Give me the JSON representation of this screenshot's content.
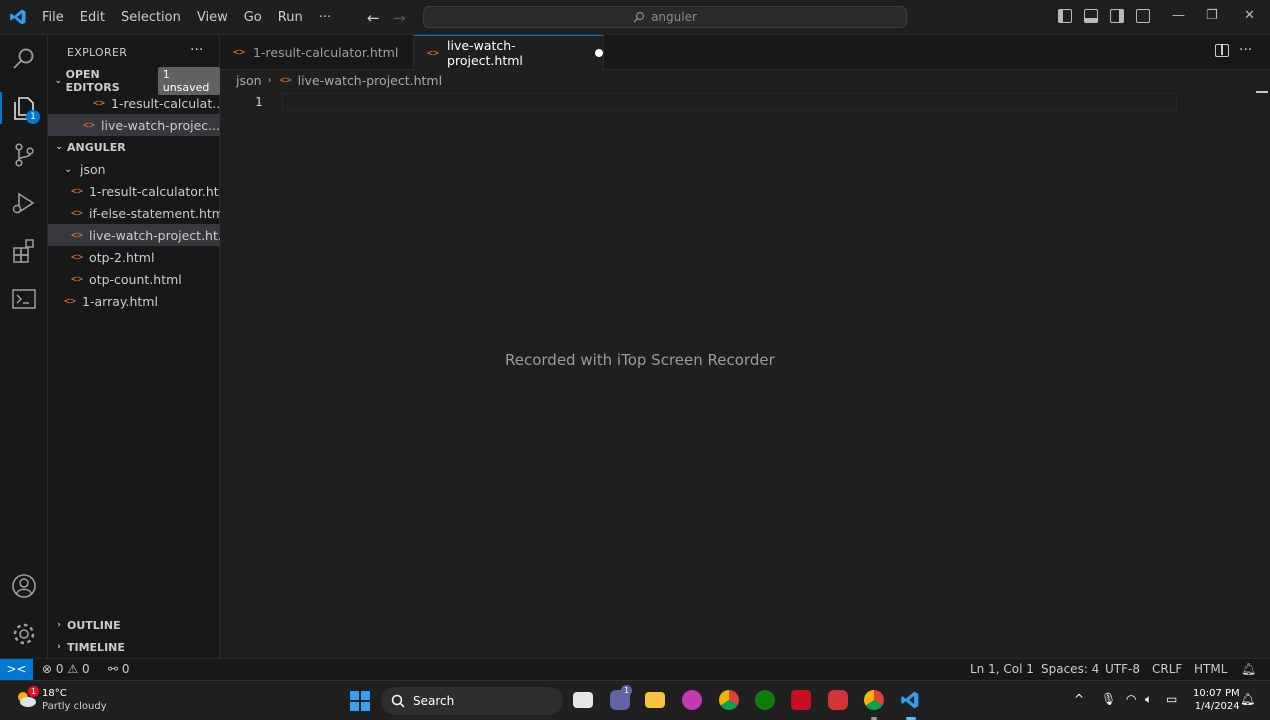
{
  "titlebar": {
    "menu": [
      "File",
      "Edit",
      "Selection",
      "View",
      "Go",
      "Run",
      "···"
    ],
    "search_text": "anguler",
    "window_controls": [
      "minimize-icon",
      "restore-icon",
      "close-icon"
    ]
  },
  "sidebar": {
    "title": "EXPLORER",
    "more": "···",
    "open_editors": {
      "label": "OPEN EDITORS",
      "badge": "1 unsaved",
      "items": [
        "1-result-calculat...",
        "live-watch-projec..."
      ]
    },
    "folder": {
      "label": "ANGULER",
      "subfolder": "json",
      "files": [
        "1-result-calculator.ht...",
        "if-else-statement.html",
        "live-watch-project.ht...",
        "otp-2.html",
        "otp-count.html"
      ],
      "root_files": [
        "1-array.html"
      ]
    },
    "outline": "OUTLINE",
    "timeline": "TIMELINE"
  },
  "tabs": [
    {
      "label": "1-result-calculator.html",
      "active": false
    },
    {
      "label": "live-watch-project.html",
      "active": true,
      "modified": true
    }
  ],
  "editor": {
    "breadcrumb": [
      "json",
      "live-watch-project.html"
    ],
    "line_number": "1",
    "watermark": "Recorded with iTop Screen Recorder"
  },
  "statusbar": {
    "remote_icon": "><",
    "errors": "0",
    "warnings": "0",
    "ports": "0",
    "position": "Ln 1, Col 1",
    "spaces": "Spaces: 4",
    "encoding": "UTF-8",
    "eol": "CRLF",
    "language": "HTML"
  },
  "taskbar": {
    "temperature": "18°C",
    "condition": "Partly cloudy",
    "search_label": "Search",
    "time": "10:07 PM",
    "date": "1/4/2024",
    "weather_alert": "1",
    "teams_badge": "1"
  },
  "colors": {
    "accent": "#0078d4",
    "file_icon": "#e37933",
    "background": "#1f1f1f",
    "sidebar": "#181818"
  }
}
